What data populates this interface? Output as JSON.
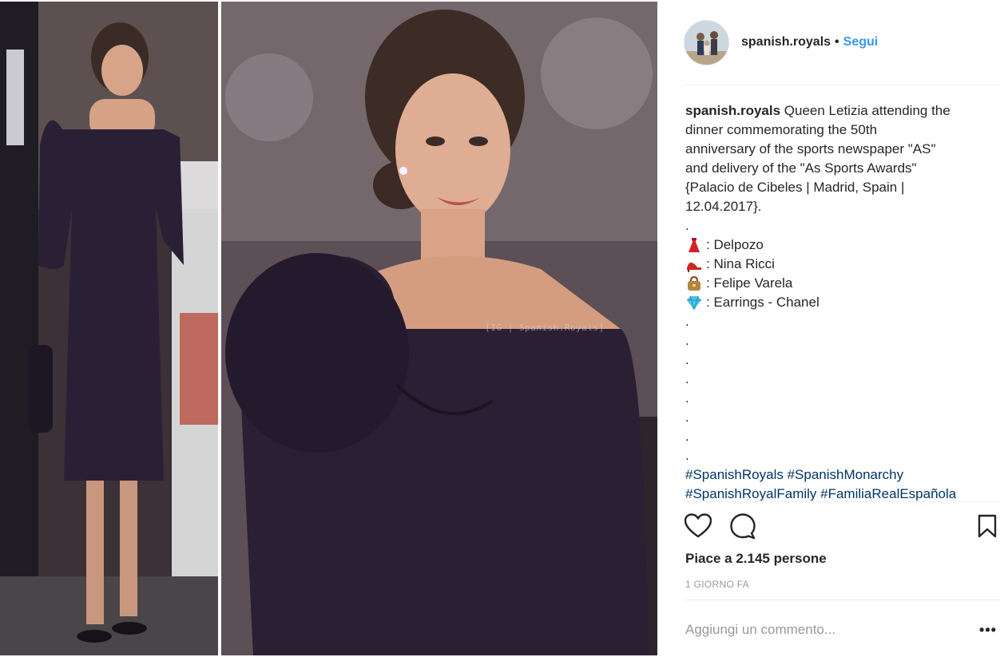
{
  "post": {
    "username": "spanish.royals",
    "separator": "•",
    "follow_label": "Segui",
    "watermark": "[IG | Spanish.Royals]",
    "caption": {
      "username": "spanish.royals",
      "lines": [
        " Queen Letizia attending the",
        "dinner commemorating the 50th",
        "anniversary of the sports newspaper \"AS\"",
        "and delivery of the \"As Sports Awards\"",
        "{Palacio de Cibeles | Madrid, Spain |",
        "12.04.2017}.",
        "."
      ],
      "credits": [
        {
          "icon": "dress-emoji-icon",
          "text": " : Delpozo"
        },
        {
          "icon": "high-heel-emoji-icon",
          "text": " : Nina Ricci"
        },
        {
          "icon": "handbag-emoji-icon",
          "text": " : Felipe Varela"
        },
        {
          "icon": "gem-emoji-icon",
          "text": " : Earrings - Chanel"
        }
      ],
      "dots": [
        ".",
        ".",
        ".",
        ".",
        ".",
        ".",
        ".",
        "."
      ],
      "hashtags_line1": [
        "#SpanishRoyals",
        "#SpanishMonarchy"
      ],
      "hashtags_line2": [
        "#SpanishRoyalFamily",
        "#FamiliaRealEspañola"
      ]
    },
    "likes_text": "Piace a 2.145 persone",
    "timestamp": "1 GIORNO FA",
    "comment_placeholder": "Aggiungi un commento...",
    "more_label": "•••"
  },
  "icons": {
    "like": "heart-icon",
    "comment": "comment-bubble-icon",
    "save": "bookmark-icon",
    "options": "more-options-icon"
  },
  "colors": {
    "accent_link": "#3897f0",
    "hashtag": "#003569",
    "muted": "#999999",
    "text": "#262626"
  }
}
